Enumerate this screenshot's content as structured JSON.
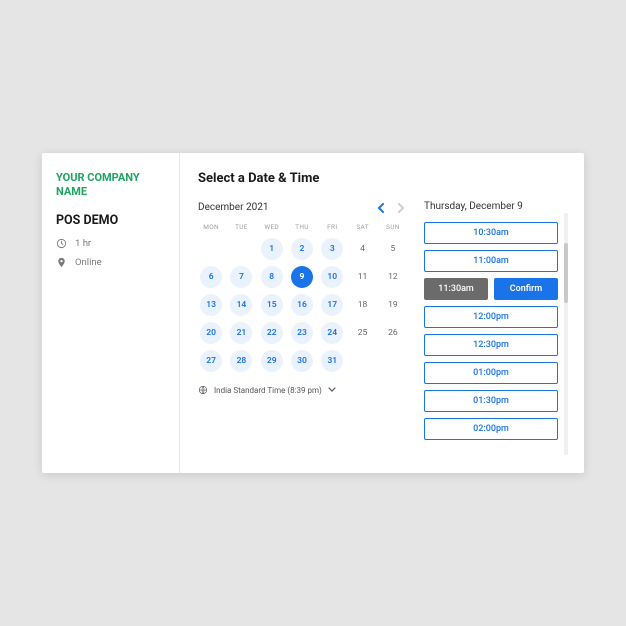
{
  "sidebar": {
    "company": "YOUR COMPANY NAME",
    "title": "POS DEMO",
    "duration": "1 hr",
    "location": "Online"
  },
  "heading": "Select a Date & Time",
  "calendar": {
    "month_label": "December 2021",
    "dow": [
      "MON",
      "TUE",
      "WED",
      "THU",
      "FRI",
      "SAT",
      "SUN"
    ],
    "weeks": [
      [
        null,
        null,
        {
          "n": 1,
          "a": true
        },
        {
          "n": 2,
          "a": true
        },
        {
          "n": 3,
          "a": true
        },
        {
          "n": 4,
          "a": false
        },
        {
          "n": 5,
          "a": false
        }
      ],
      [
        {
          "n": 6,
          "a": true
        },
        {
          "n": 7,
          "a": true
        },
        {
          "n": 8,
          "a": true
        },
        {
          "n": 9,
          "a": true,
          "sel": true
        },
        {
          "n": 10,
          "a": true
        },
        {
          "n": 11,
          "a": false
        },
        {
          "n": 12,
          "a": false
        }
      ],
      [
        {
          "n": 13,
          "a": true
        },
        {
          "n": 14,
          "a": true
        },
        {
          "n": 15,
          "a": true
        },
        {
          "n": 16,
          "a": true
        },
        {
          "n": 17,
          "a": true
        },
        {
          "n": 18,
          "a": false
        },
        {
          "n": 19,
          "a": false
        }
      ],
      [
        {
          "n": 20,
          "a": true
        },
        {
          "n": 21,
          "a": true
        },
        {
          "n": 22,
          "a": true
        },
        {
          "n": 23,
          "a": true
        },
        {
          "n": 24,
          "a": true
        },
        {
          "n": 25,
          "a": false
        },
        {
          "n": 26,
          "a": false
        }
      ],
      [
        {
          "n": 27,
          "a": true
        },
        {
          "n": 28,
          "a": true
        },
        {
          "n": 29,
          "a": true
        },
        {
          "n": 30,
          "a": true
        },
        {
          "n": 31,
          "a": true
        },
        null,
        null
      ]
    ],
    "timezone_label": "India Standard Time (8:39 pm)"
  },
  "times": {
    "date_label": "Thursday, December 9",
    "slots": [
      "10:30am",
      "11:00am",
      "12:00pm",
      "12:30pm",
      "01:00pm",
      "01:30pm",
      "02:00pm"
    ],
    "selected": "11:30am",
    "confirm_label": "Confirm"
  }
}
